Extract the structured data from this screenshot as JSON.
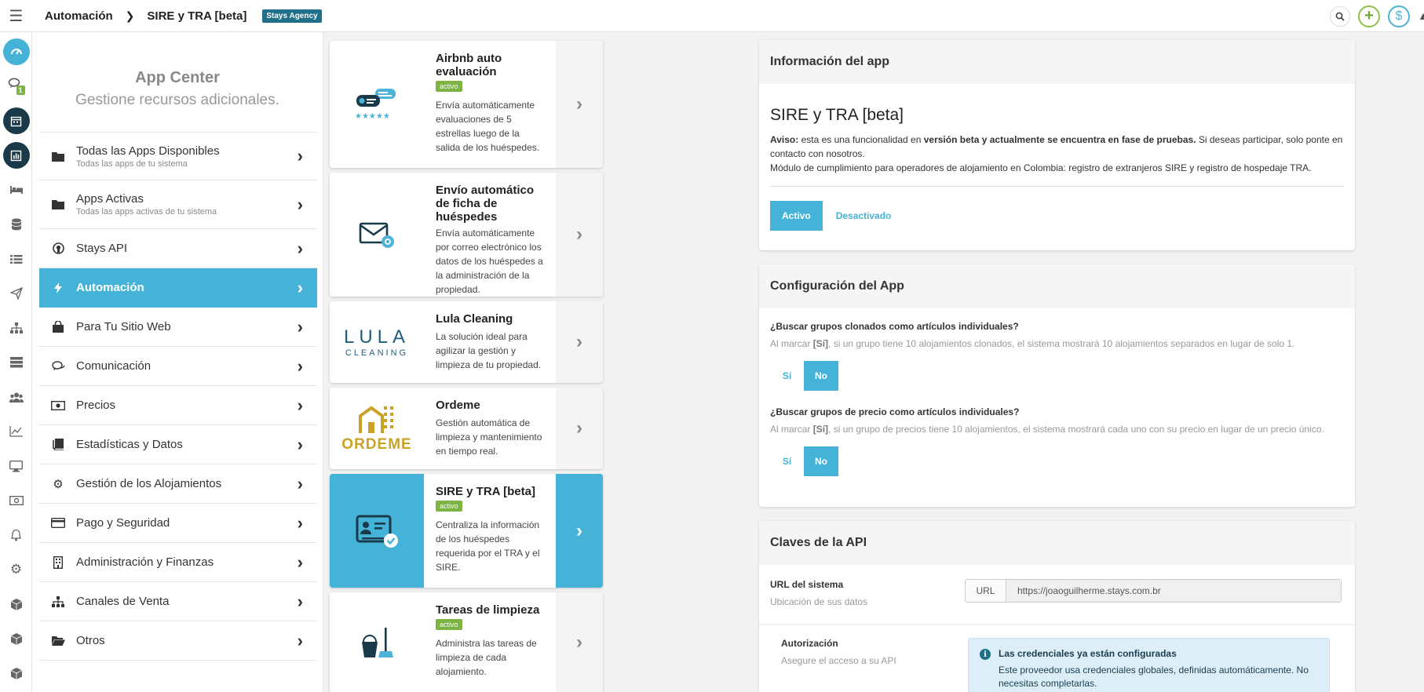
{
  "topbar": {
    "breadcrumb": [
      "Automación",
      "SIRE y TRA [beta]"
    ],
    "agency_badge": "Stays Agency"
  },
  "rail": {
    "icons": [
      "dashboard-icon",
      "chat-icon",
      "calendar-icon",
      "chart-icon",
      "bed-icon",
      "database-icon",
      "list-icon",
      "send-icon",
      "sitemap-icon",
      "server-icon",
      "users-icon",
      "line-chart-icon",
      "monitor-icon",
      "money-icon",
      "bell-icon",
      "gear-icon",
      "cube-icon",
      "cube-icon",
      "cube-icon"
    ],
    "chat_badge": "1"
  },
  "app_center": {
    "title": "App Center",
    "subtitle": "Gestione recursos adicionales.",
    "items": [
      {
        "label": "Todas las Apps Disponibles",
        "sub": "Todas las apps de tu sistema",
        "icon": "folder-icon"
      },
      {
        "label": "Apps Activas",
        "sub": "Todas las apps activas de tu sistema",
        "icon": "folder-icon"
      },
      {
        "label": "Stays API",
        "icon": "github-icon"
      },
      {
        "label": "Automación",
        "icon": "bolt-icon",
        "active": true
      },
      {
        "label": "Para Tu Sitio Web",
        "icon": "shopping-bag-icon"
      },
      {
        "label": "Comunicación",
        "icon": "comments-icon"
      },
      {
        "label": "Precios",
        "icon": "money-icon"
      },
      {
        "label": "Estadísticas y Datos",
        "icon": "book-icon"
      },
      {
        "label": "Gestión de los Alojamientos",
        "icon": "cogs-icon"
      },
      {
        "label": "Pago y Seguridad",
        "icon": "credit-card-icon"
      },
      {
        "label": "Administración y Finanzas",
        "icon": "building-icon"
      },
      {
        "label": "Canales de Venta",
        "icon": "sitemap-icon"
      },
      {
        "label": "Otros",
        "icon": "folder-open-icon"
      }
    ]
  },
  "cards": [
    {
      "title": "Airbnb auto evaluación",
      "badge": "activo",
      "desc": "Envía automáticamente evaluaciones de 5 estrellas luego de la salida de los huéspedes.",
      "icon": "review-stars-icon"
    },
    {
      "title": "Envío automático de ficha de huéspedes",
      "badge": "",
      "desc": "Envía automáticamente por correo electrónico los datos de los huéspedes a la administración de la propiedad.",
      "icon": "mail-gear-icon"
    },
    {
      "title": "Lula Cleaning",
      "badge": "",
      "desc": "La solución ideal para agilizar la gestión y limpieza de tu propiedad.",
      "icon": "lula-logo",
      "logo_top": "LULA",
      "logo_bottom": "CLEANING"
    },
    {
      "title": "Ordeme",
      "badge": "",
      "desc": "Gestión automática de limpieza y mantenimiento en tiempo real.",
      "icon": "ordeme-logo",
      "logo_text": "ORDEME"
    },
    {
      "title": "SIRE y TRA [beta]",
      "badge": "activo",
      "desc": "Centraliza la información de los huéspedes requerida por el TRA y el SIRE.",
      "icon": "id-card-check-icon",
      "active": true
    },
    {
      "title": "Tareas de limpieza",
      "badge": "activo",
      "desc": "Administra las tareas de limpieza de cada alojamiento.",
      "icon": "bucket-broom-icon"
    }
  ],
  "info_panel": {
    "header": "Información del app",
    "title": "SIRE y TRA [beta]",
    "notice_label": "Aviso:",
    "notice_pre": "esta es una funcionalidad en",
    "notice_bold": "versión beta y actualmente se encuentra en fase de pruebas.",
    "notice_post": "Si deseas participar, solo ponte en contacto con nosotros.",
    "module_text": "Módulo de cumplimiento para operadores de alojamiento en Colombia: registro de extranjeros SIRE y registro de hospedaje TRA.",
    "btn_active": "Activo",
    "btn_inactive": "Desactivado"
  },
  "config_panel": {
    "header": "Configuración del App",
    "q1": "¿Buscar grupos clonados como artículos individuales?",
    "d1_pre": "Al marcar",
    "d1_mark": "[Sí]",
    "d1_post": ", si un grupo tiene 10 alojamientos clonados, el sistema mostrará 10 alojamientos separados en lugar de solo 1.",
    "q2": "¿Buscar grupos de precio como artículos individuales?",
    "d2_pre": "Al marcar",
    "d2_mark": "[Sí]",
    "d2_post": ", si un grupo de precios tiene 10 alojamientos, el sistema mostrará cada uno con su precio en lugar de un precio único.",
    "yes": "Sí",
    "no": "No"
  },
  "api_panel": {
    "header": "Claves de la API",
    "url_label": "URL del sistema",
    "url_sub": "Ubicación de sus datos",
    "url_addon": "URL",
    "url_value": "https://joaoguilherme.stays.com.br",
    "auth_label": "Autorización",
    "auth_sub": "Asegure el acceso a su API",
    "alert_title": "Las credenciales ya están configuradas",
    "alert_text": "Este proveedor usa credenciales globales, definidas automáticamente. No necesitas completarlas."
  }
}
